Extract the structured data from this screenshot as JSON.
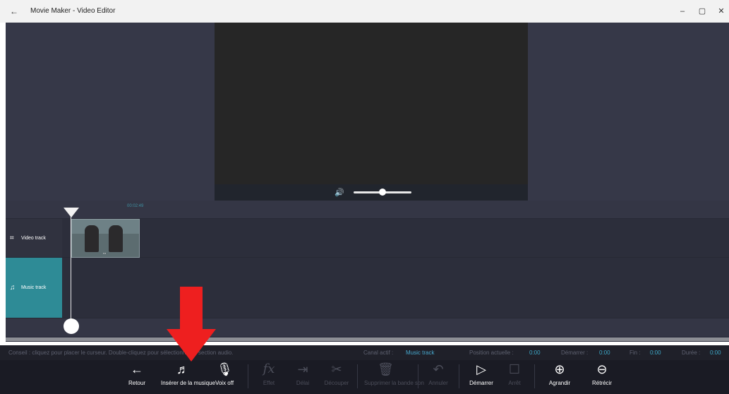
{
  "window": {
    "title": "Movie Maker - Video Editor",
    "back_icon": "arrow-left-icon",
    "controls": {
      "minimize": "–",
      "maximize": "▢",
      "close": "✕"
    }
  },
  "preview": {
    "volume_icon": "speaker-icon",
    "volume_level": 0.5
  },
  "timeline": {
    "current_time_label": "00:02:49",
    "tracks": [
      {
        "label": "Video track",
        "icon": "film-strip-icon"
      },
      {
        "label": "Music track",
        "icon": "music-note-icon"
      }
    ]
  },
  "status": {
    "hint": "Conseil : cliquez pour placer le curseur. Double-cliquez pour sélectionner la section audio.",
    "active_channel_label": "Canal actif :",
    "active_channel_value": "Music track",
    "current_position_label": "Position actuelle :",
    "current_position_value": "0:00",
    "start_label": "Démarrer :",
    "start_value": "0:00",
    "end_label": "Fin :",
    "end_value": "0:00",
    "duration_label": "Durée :",
    "duration_value": "0:00"
  },
  "toolbar": {
    "items": [
      {
        "label": "Retour",
        "icon": "arrow-left-icon",
        "enabled": true
      },
      {
        "label": "Insérer de la musique",
        "icon": "music-add-icon",
        "enabled": true
      },
      {
        "label": "Voix off",
        "icon": "microphone-icon",
        "enabled": true
      },
      {
        "label": "Effet",
        "icon": "fx-icon",
        "enabled": false
      },
      {
        "label": "Délai",
        "icon": "delay-icon",
        "enabled": false
      },
      {
        "label": "Découper",
        "icon": "scissors-icon",
        "enabled": false
      },
      {
        "label": "Supprimer la bande son",
        "icon": "trash-icon",
        "enabled": false
      },
      {
        "label": "Annuler",
        "icon": "undo-icon",
        "enabled": false
      },
      {
        "label": "Démarrer",
        "icon": "play-icon",
        "enabled": true
      },
      {
        "label": "Arrêt",
        "icon": "stop-icon",
        "enabled": false
      },
      {
        "label": "Agrandir",
        "icon": "zoom-in-icon",
        "enabled": true
      },
      {
        "label": "Rétrécir",
        "icon": "zoom-out-icon",
        "enabled": true
      }
    ]
  },
  "colors": {
    "accent": "#2e8b96",
    "status_value": "#3da7c7",
    "annotation_arrow": "#ee1f1f"
  }
}
